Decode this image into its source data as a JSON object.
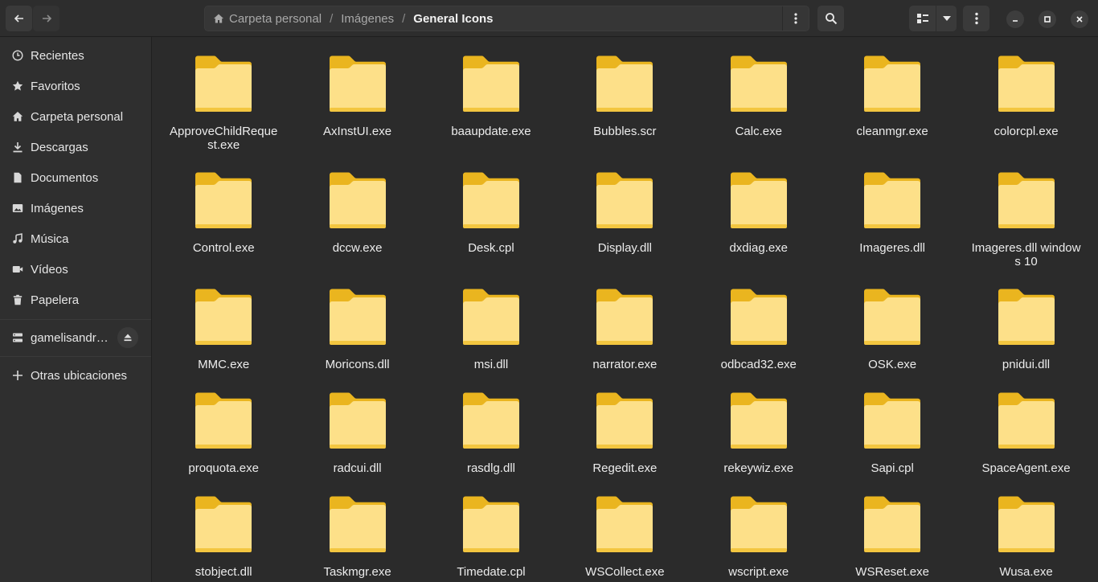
{
  "path": {
    "crumbs": [
      "Carpeta personal",
      "Imágenes",
      "General Icons"
    ]
  },
  "sidebar": {
    "items": [
      {
        "label": "Recientes",
        "icon": "clock-icon"
      },
      {
        "label": "Favoritos",
        "icon": "star-icon"
      },
      {
        "label": "Carpeta personal",
        "icon": "home-icon"
      },
      {
        "label": "Descargas",
        "icon": "download-icon"
      },
      {
        "label": "Documentos",
        "icon": "document-icon"
      },
      {
        "label": "Imágenes",
        "icon": "image-icon"
      },
      {
        "label": "Música",
        "icon": "music-icon"
      },
      {
        "label": "Vídeos",
        "icon": "video-icon"
      },
      {
        "label": "Papelera",
        "icon": "trash-icon"
      }
    ],
    "drive": {
      "label": "gamelisandr…",
      "icon": "drive-icon"
    },
    "other": {
      "label": "Otras ubicaciones",
      "icon": "plus-icon"
    }
  },
  "files": [
    "ApproveChildRequest.exe",
    "AxInstUI.exe",
    "baaupdate.exe",
    "Bubbles.scr",
    "Calc.exe",
    "cleanmgr.exe",
    "colorcpl.exe",
    "Control.exe",
    "dccw.exe",
    "Desk.cpl",
    "Display.dll",
    "dxdiag.exe",
    "Imageres.dll",
    "Imageres.dll windows 10",
    "MMC.exe",
    "Moricons.dll",
    "msi.dll",
    "narrator.exe",
    "odbcad32.exe",
    "OSK.exe",
    "pnidui.dll",
    "proquota.exe",
    "radcui.dll",
    "rasdlg.dll",
    "Regedit.exe",
    "rekeywiz.exe",
    "Sapi.cpl",
    "SpaceAgent.exe",
    "stobject.dll",
    "Taskmgr.exe",
    "Timedate.cpl",
    "WSCollect.exe",
    "wscript.exe",
    "WSReset.exe",
    "Wusa.exe"
  ],
  "colors": {
    "folder_back": "#eab51f",
    "folder_front": "#fde089",
    "accent": "#f5c430"
  }
}
